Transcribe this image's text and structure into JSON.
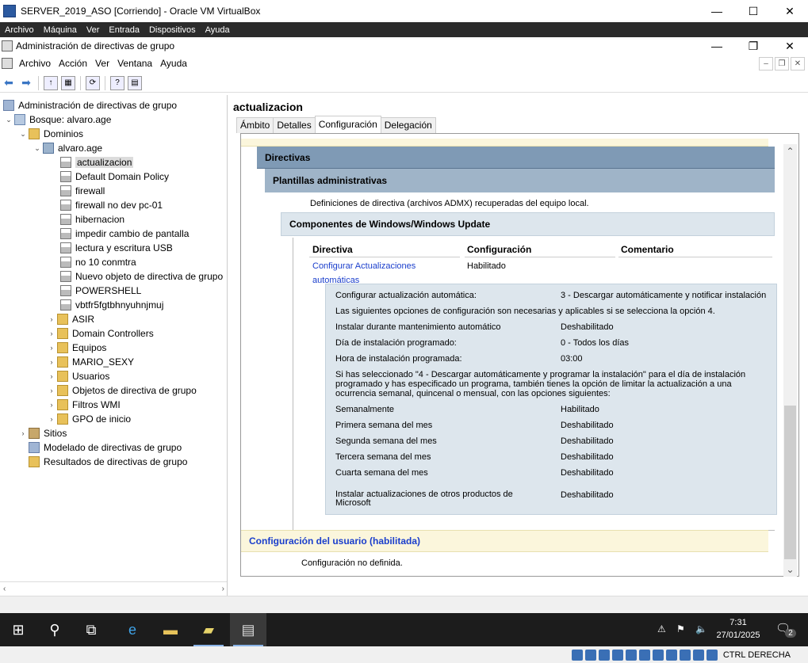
{
  "vbox": {
    "title": "SERVER_2019_ASO [Corriendo] - Oracle VM VirtualBox",
    "menu": [
      "Archivo",
      "Máquina",
      "Ver",
      "Entrada",
      "Dispositivos",
      "Ayuda"
    ],
    "status": {
      "host_key": "CTRL DERECHA"
    }
  },
  "gpmc": {
    "title": "Administración de directivas de grupo",
    "menu": [
      "Archivo",
      "Acción",
      "Ver",
      "Ventana",
      "Ayuda"
    ]
  },
  "tree": {
    "root": "Administración de directivas de grupo",
    "forest": "Bosque: alvaro.age",
    "domains": "Dominios",
    "domain": "alvaro.age",
    "gpos": [
      "actualizacion",
      "Default Domain Policy",
      "firewall",
      "firewall no dev pc-01",
      "hibernacion",
      "impedir cambio de pantalla",
      "lectura y escritura USB",
      "no 10 conmtra",
      "Nuevo objeto de directiva de grupo",
      "POWERSHELL",
      "vbtfr5fgtbhnyuhnjmuj"
    ],
    "folders": [
      "ASIR",
      "Domain Controllers",
      "Equipos",
      "MARIO_SEXY",
      "Usuarios",
      "Objetos de directiva de grupo",
      "Filtros WMI",
      "GPO de inicio"
    ],
    "sites": "Sitios",
    "modeling": "Modelado de directivas de grupo",
    "results": "Resultados de directivas de grupo"
  },
  "detail": {
    "title": "actualizacion",
    "tabs": [
      "Ámbito",
      "Detalles",
      "Configuración",
      "Delegación"
    ],
    "directivas": "Directivas",
    "plantillas": "Plantillas administrativas",
    "definiciones": "Definiciones de directiva (archivos ADMX) recuperadas del equipo local.",
    "componentes": "Componentes de Windows/Windows Update",
    "col_directiva": "Directiva",
    "col_config": "Configuración",
    "col_comentario": "Comentario",
    "policy_link_1": "Configurar Actualizaciones",
    "policy_link_2": "automáticas",
    "policy_state": "Habilitado",
    "settings": [
      {
        "k": "Configurar actualización automática:",
        "v": "3 - Descargar automáticamente y notificar instalación"
      },
      {
        "k": "Las siguientes opciones de configuración son necesarias y aplicables si se selecciona la opción 4.",
        "v": ""
      },
      {
        "k": "Instalar durante mantenimiento automático",
        "v": "Deshabilitado"
      },
      {
        "k": "Día de instalación programado:",
        "v": "0 - Todos los días"
      },
      {
        "k": "Hora de instalación programada:",
        "v": "03:00"
      }
    ],
    "note": "Si has seleccionado \"4 - Descargar automáticamente y programar la instalación\" para el día de instalación programado y has especificado un programa, también tienes la opción de limitar la actualización a una ocurrencia semanal, quincenal o mensual, con las opciones siguientes:",
    "settings2": [
      {
        "k": "Semanalmente",
        "v": "Habilitado"
      },
      {
        "k": "Primera semana del mes",
        "v": "Deshabilitado"
      },
      {
        "k": "Segunda semana del mes",
        "v": "Deshabilitado"
      },
      {
        "k": "Tercera semana del mes",
        "v": "Deshabilitado"
      },
      {
        "k": "Cuarta semana del mes",
        "v": "Deshabilitado"
      }
    ],
    "other_k": "Instalar actualizaciones de otros productos de Microsoft",
    "other_v": "Deshabilitado",
    "user_config": "Configuración del usuario (habilitada)",
    "user_undefined": "Configuración no definida."
  },
  "taskbar": {
    "time": "7:31",
    "date": "27/01/2025",
    "notif_count": "2"
  }
}
